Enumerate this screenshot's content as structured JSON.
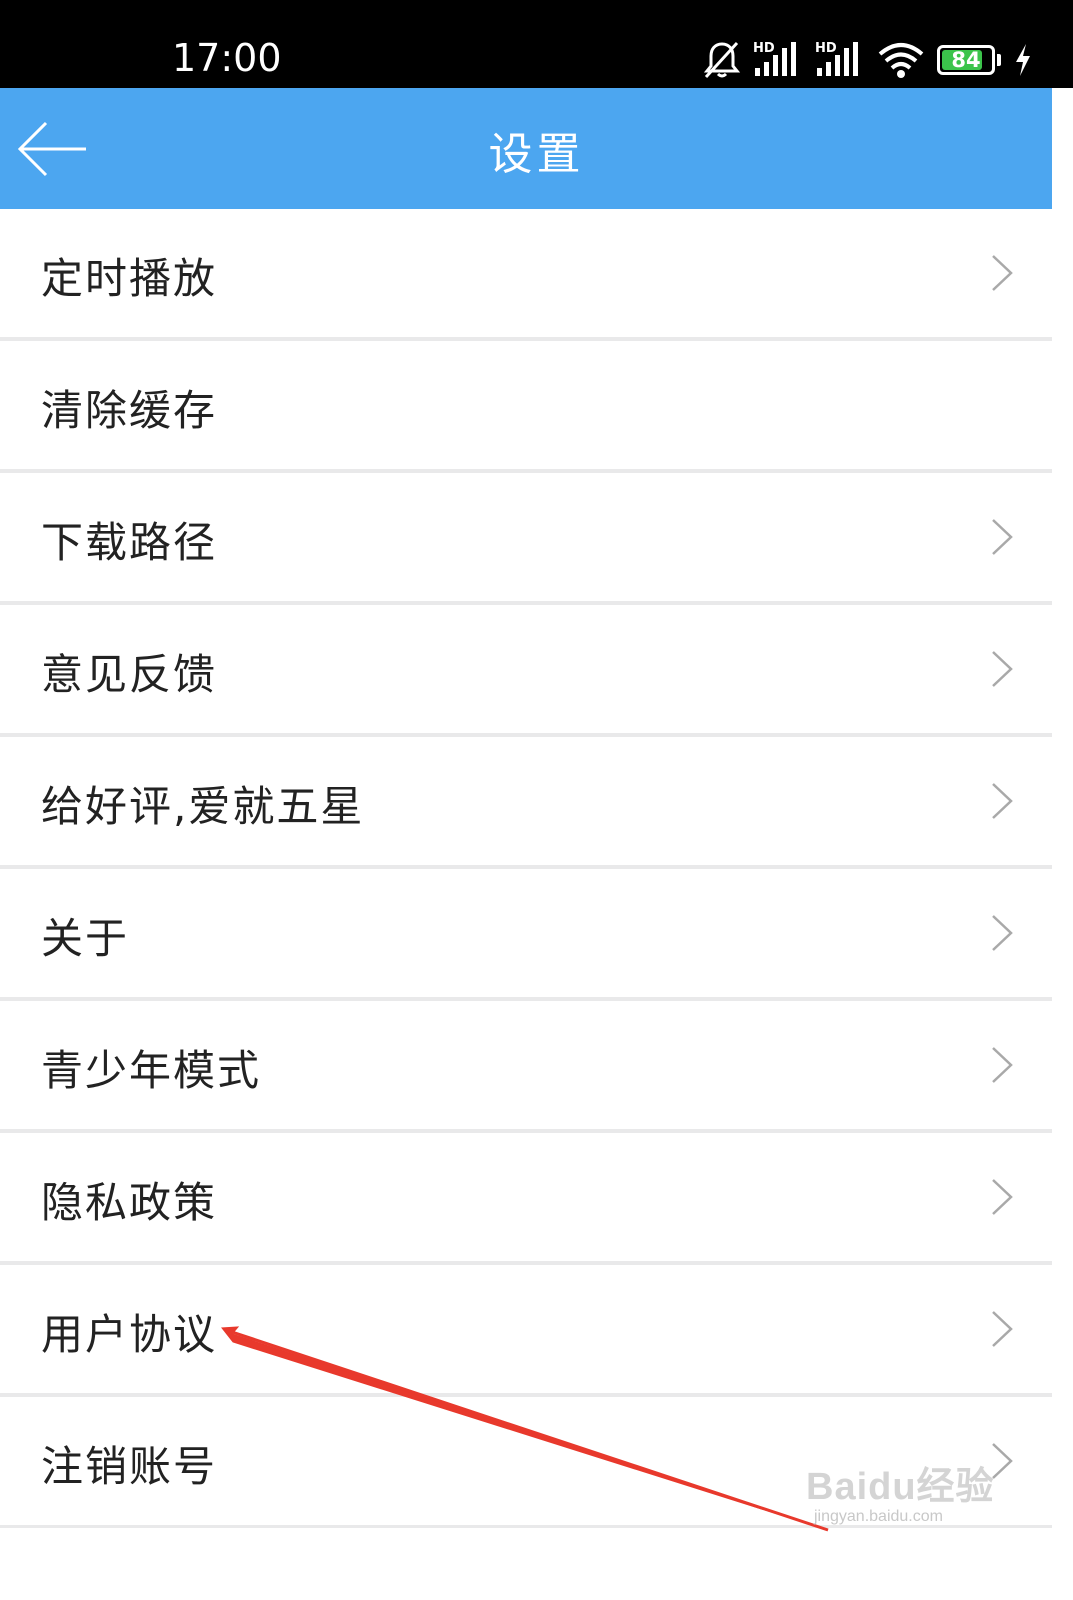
{
  "status_bar": {
    "time": "17:00",
    "battery_level": "84",
    "battery_percent": 84,
    "icons": [
      "bell-muted-icon",
      "hd-signal-icon",
      "hd-signal-icon",
      "wifi-icon",
      "battery-icon",
      "charging-icon"
    ]
  },
  "app_bar": {
    "title": "设置",
    "back_icon": "back-arrow-icon",
    "color": "#4ca6f0"
  },
  "settings": {
    "items": [
      {
        "label": "定时播放",
        "has_chevron": true
      },
      {
        "label": "清除缓存",
        "has_chevron": false
      },
      {
        "label": "下载路径",
        "has_chevron": true
      },
      {
        "label": "意见反馈",
        "has_chevron": true
      },
      {
        "label": "给好评,爱就五星",
        "has_chevron": true
      },
      {
        "label": "关于",
        "has_chevron": true
      },
      {
        "label": "青少年模式",
        "has_chevron": true
      },
      {
        "label": "隐私政策",
        "has_chevron": true
      },
      {
        "label": "用户协议",
        "has_chevron": true
      },
      {
        "label": "注销账号",
        "has_chevron": true
      }
    ]
  },
  "annotation": {
    "color": "#e8392c",
    "points_to": "用户协议"
  },
  "watermark": {
    "logo": "Baidu经验",
    "url": "jingyan.baidu.com"
  }
}
